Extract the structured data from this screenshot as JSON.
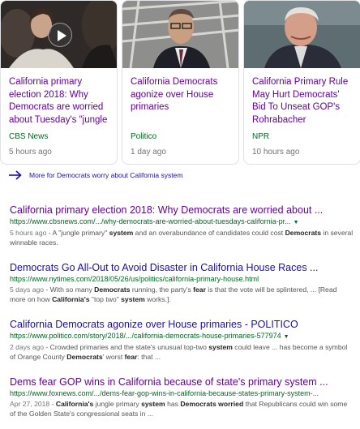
{
  "top_stories": [
    {
      "title": "California primary election 2018: Why Democrats are worried about Tuesday's \"jungle primary\"",
      "source": "CBS News",
      "time": "5 hours ago",
      "has_video": true
    },
    {
      "title": "California Democrats agonize over House primaries",
      "source": "Politico",
      "time": "1 day ago",
      "has_video": false
    },
    {
      "title": "California Primary Rule May Hurt Democrats' Bid To Unseat GOP's Rohrabacher",
      "source": "NPR",
      "time": "10 hours ago",
      "has_video": false
    }
  ],
  "more_link": "More for Democrats worry about California system",
  "results": [
    {
      "title": "California primary election 2018: Why Democrats are worried about ...",
      "url": "https://www.cbsnews.com/.../why-democrats-are-worried-about-tuesdays-california-pr...",
      "date": "5 hours ago",
      "snippet": [
        {
          "t": " - A \"jungle primary\" ",
          "b": false
        },
        {
          "t": "system",
          "b": true
        },
        {
          "t": " and an overabundance of candidates could cost ",
          "b": false
        },
        {
          "t": "Democrats",
          "b": true
        },
        {
          "t": " in several winnable races.",
          "b": false
        }
      ]
    },
    {
      "title": "Democrats Go All-Out to Avoid Disaster in California House Races ...",
      "url": "https://www.nytimes.com/2018/05/26/us/politics/california-primary-house.html",
      "date": "5 days ago",
      "snippet": [
        {
          "t": " - With so many ",
          "b": false
        },
        {
          "t": "Democrats",
          "b": true
        },
        {
          "t": " running, the party's ",
          "b": false
        },
        {
          "t": "fear",
          "b": true
        },
        {
          "t": " is that the vote will be splintered, ... [Read more on how ",
          "b": false
        },
        {
          "t": "California's",
          "b": true
        },
        {
          "t": " \"top two\" ",
          "b": false
        },
        {
          "t": "system",
          "b": true
        },
        {
          "t": " works.].",
          "b": false
        }
      ]
    },
    {
      "title": "California Democrats agonize over House primaries - POLITICO",
      "url": "https://www.politico.com/story/2018/.../california-democrats-house-primaries-577974",
      "date": "2 days ago",
      "snippet": [
        {
          "t": " - Crowded primaries and the state's unusual top-two ",
          "b": false
        },
        {
          "t": "system",
          "b": true
        },
        {
          "t": " could leave ... has become a symbol of Orange County ",
          "b": false
        },
        {
          "t": "Democrats",
          "b": true
        },
        {
          "t": "' worst ",
          "b": false
        },
        {
          "t": "fear",
          "b": true
        },
        {
          "t": ": that ...",
          "b": false
        }
      ]
    },
    {
      "title": "Dems fear GOP wins in California because of state's primary system ...",
      "url": "https://www.foxnews.com/.../dems-fear-gop-wins-in-california-because-states-primary-system-...",
      "date": "Apr 27, 2018",
      "snippet": [
        {
          "t": " - ",
          "b": false
        },
        {
          "t": "California's",
          "b": true
        },
        {
          "t": " jungle primary ",
          "b": false
        },
        {
          "t": "system",
          "b": true
        },
        {
          "t": " has ",
          "b": false
        },
        {
          "t": "Democrats worried",
          "b": true
        },
        {
          "t": " that Republicans could win some of the Golden State's congressional seats in ...",
          "b": false
        }
      ]
    }
  ],
  "colors": {
    "visited_link": "#660099",
    "link": "#1a0dab",
    "url_green": "#006621",
    "snippet_gray": "#545454"
  }
}
